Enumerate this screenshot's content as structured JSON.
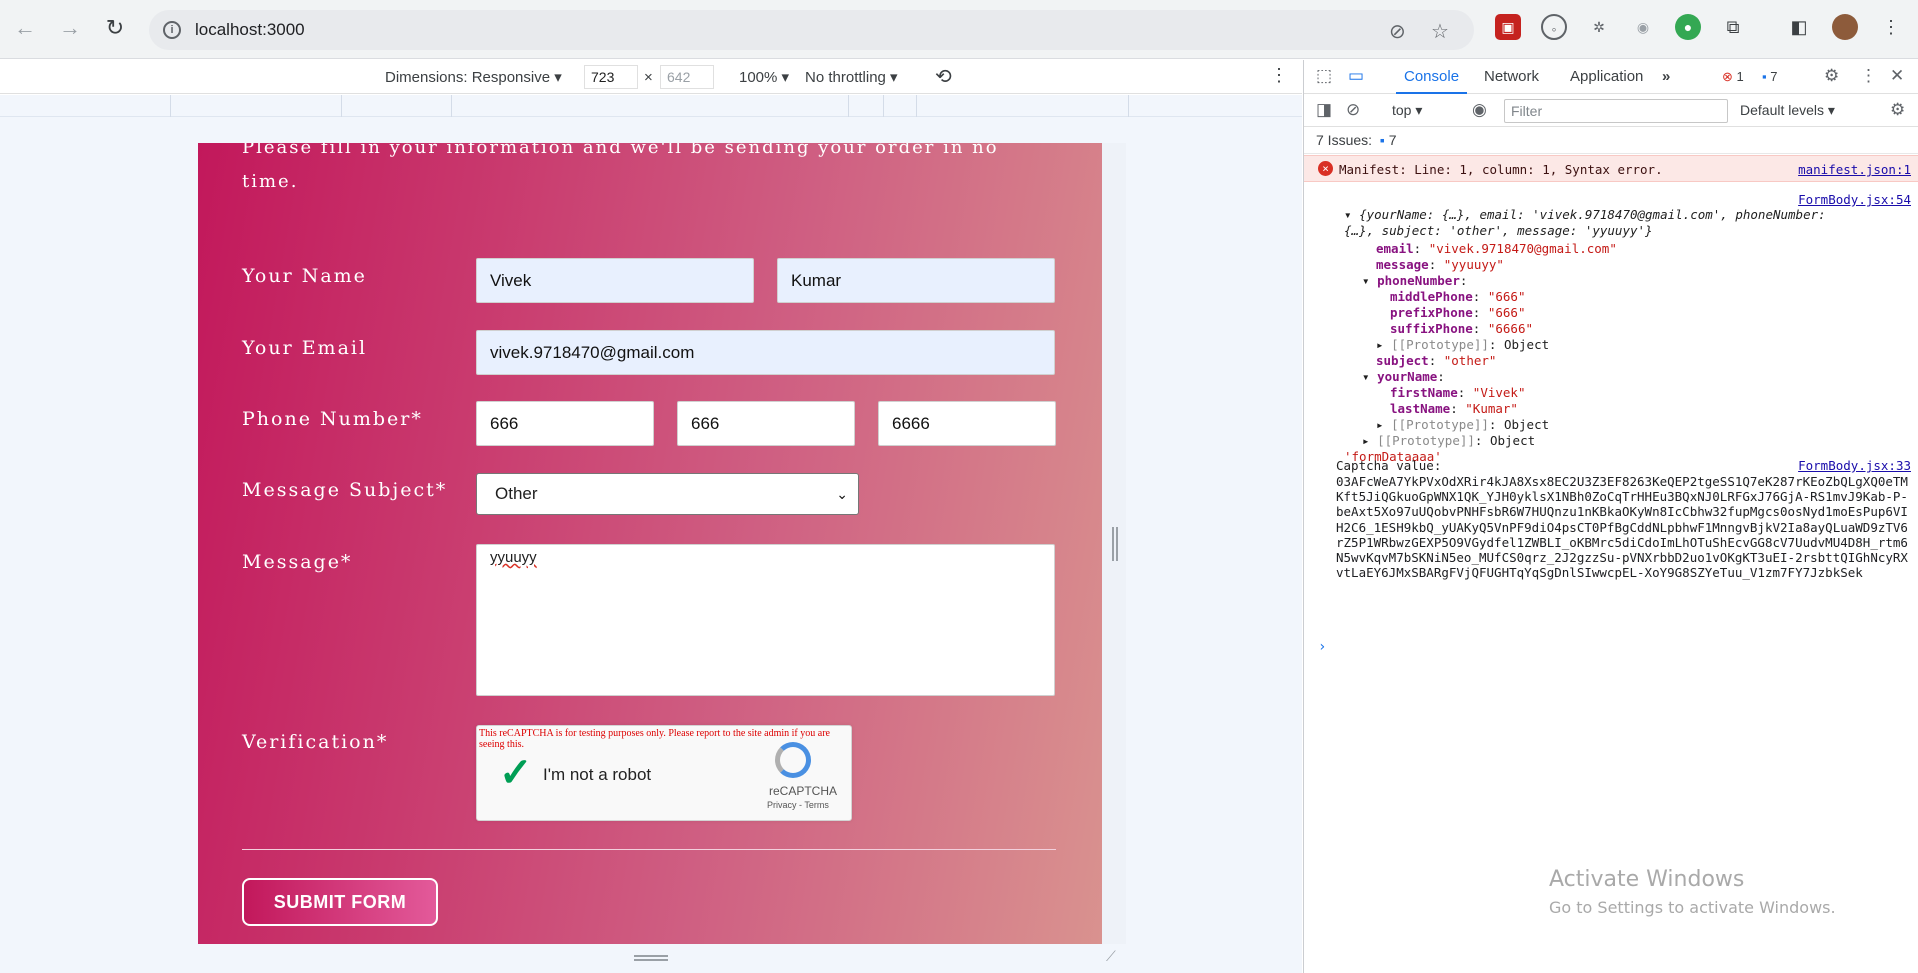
{
  "browser": {
    "url": "localhost:3000"
  },
  "device_toolbar": {
    "dimensions_label": "Dimensions: Responsive",
    "width": "723",
    "height": "642",
    "zoom": "100%",
    "throttle": "No throttling"
  },
  "form": {
    "intro": "Please fill in your information and we'll be sending your order in no time.",
    "labels": {
      "name": "Your Name",
      "email": "Your Email",
      "phone": "Phone Number*",
      "subject": "Message Subject*",
      "message": "Message*",
      "verification": "Verification*"
    },
    "first_name": "Vivek",
    "last_name": "Kumar",
    "email": "vivek.9718470@gmail.com",
    "phone": [
      "666",
      "666",
      "6666"
    ],
    "subject": "Other",
    "message": "yyuuyy",
    "captcha": {
      "warning": "This reCAPTCHA is for testing purposes only. Please report to the site admin if you are seeing this.",
      "label": "I'm not a robot",
      "brand": "reCAPTCHA",
      "terms": "Privacy - Terms"
    },
    "submit": "SUBMIT FORM"
  },
  "devtools": {
    "tabs": [
      "Console",
      "Network",
      "Application"
    ],
    "error_count": "1",
    "issue_count_badge": "7",
    "context": "top",
    "filter_placeholder": "Filter",
    "levels": "Default levels",
    "issues_label": "7 Issues:",
    "issues_count": "7",
    "error_message": "Manifest: Line: 1, column: 1, Syntax error.",
    "error_source": "manifest.json:1",
    "log1_source": "FormBody.jsx:54",
    "log2_source": "FormBody.jsx:33",
    "object_summary_1": "{yourName: {…}, email: 'vivek.9718470@gmail.com', phoneNumber:",
    "object_summary_2": "{…}, subject: 'other', message: 'yyuuyy'}",
    "email_key": "email",
    "email_val": "\"vivek.9718470@gmail.com\"",
    "message_key": "message",
    "message_val": "\"yyuuyy\"",
    "phone_key": "phoneNumber",
    "middle_key": "middlePhone",
    "middle_val": "\"666\"",
    "prefix_key": "prefixPhone",
    "prefix_val": "\"666\"",
    "suffix_key": "suffixPhone",
    "suffix_val": "\"6666\"",
    "proto_key": "[[Prototype]]",
    "proto_val": "Object",
    "subject_key": "subject",
    "subject_val": "\"other\"",
    "yourname_key": "yourName",
    "first_key": "firstName",
    "first_val": "\"Vivek\"",
    "last_key": "lastName",
    "last_val": "\"Kumar\"",
    "form_data_label": "'formDataaaa'",
    "captcha_label": "Captcha value:",
    "captcha_value": "03AFcWeA7YkPVxOdXRir4kJA8Xsx8EC2U3Z3EF8263KeQEP2tgeSS1Q7eK287rKEoZbQLgXQ0eTMKft5JiQGkuoGpWNX1QK_YJH0yklsX1NBh0ZoCqTrHHEu3BQxNJ0LRFGxJ76GjA-RS1mvJ9Kab-P-beAxt5Xo97uUQobvPNHFsbR6W7HUQnzu1nKBkaOKyWn8IcCbhw32fupMgcs0osNyd1moEsPup6VIH2C6_1ESH9kbQ_yUAKyQ5VnPF9diO4psCT0PfBgCddNLpbhwF1MnngvBjkV2Ia8ayQLuaWD9zTV6rZ5P1WRbwzGEXP5O9VGydfel1ZWBLI_oKBMrc5diCdoImLhOTuShEcvGG8cV7UudvMU4D8H_rtm6N5wvKqvM7bSKNiN5eo_MUfCS0qrz_2J2gzzSu-pVNXrbbD2uo1vOKgKT3uEI-2rsbttQIGhNcyRXvtLaEY6JMxSBARgFVjQFUGHTqYqSgDnlSIwwcpEL-XoY9G8SZYeTuu_V1zm7FY7JzbkSek"
  },
  "os_watermark": {
    "title": "Activate Windows",
    "subtitle": "Go to Settings to activate Windows."
  }
}
